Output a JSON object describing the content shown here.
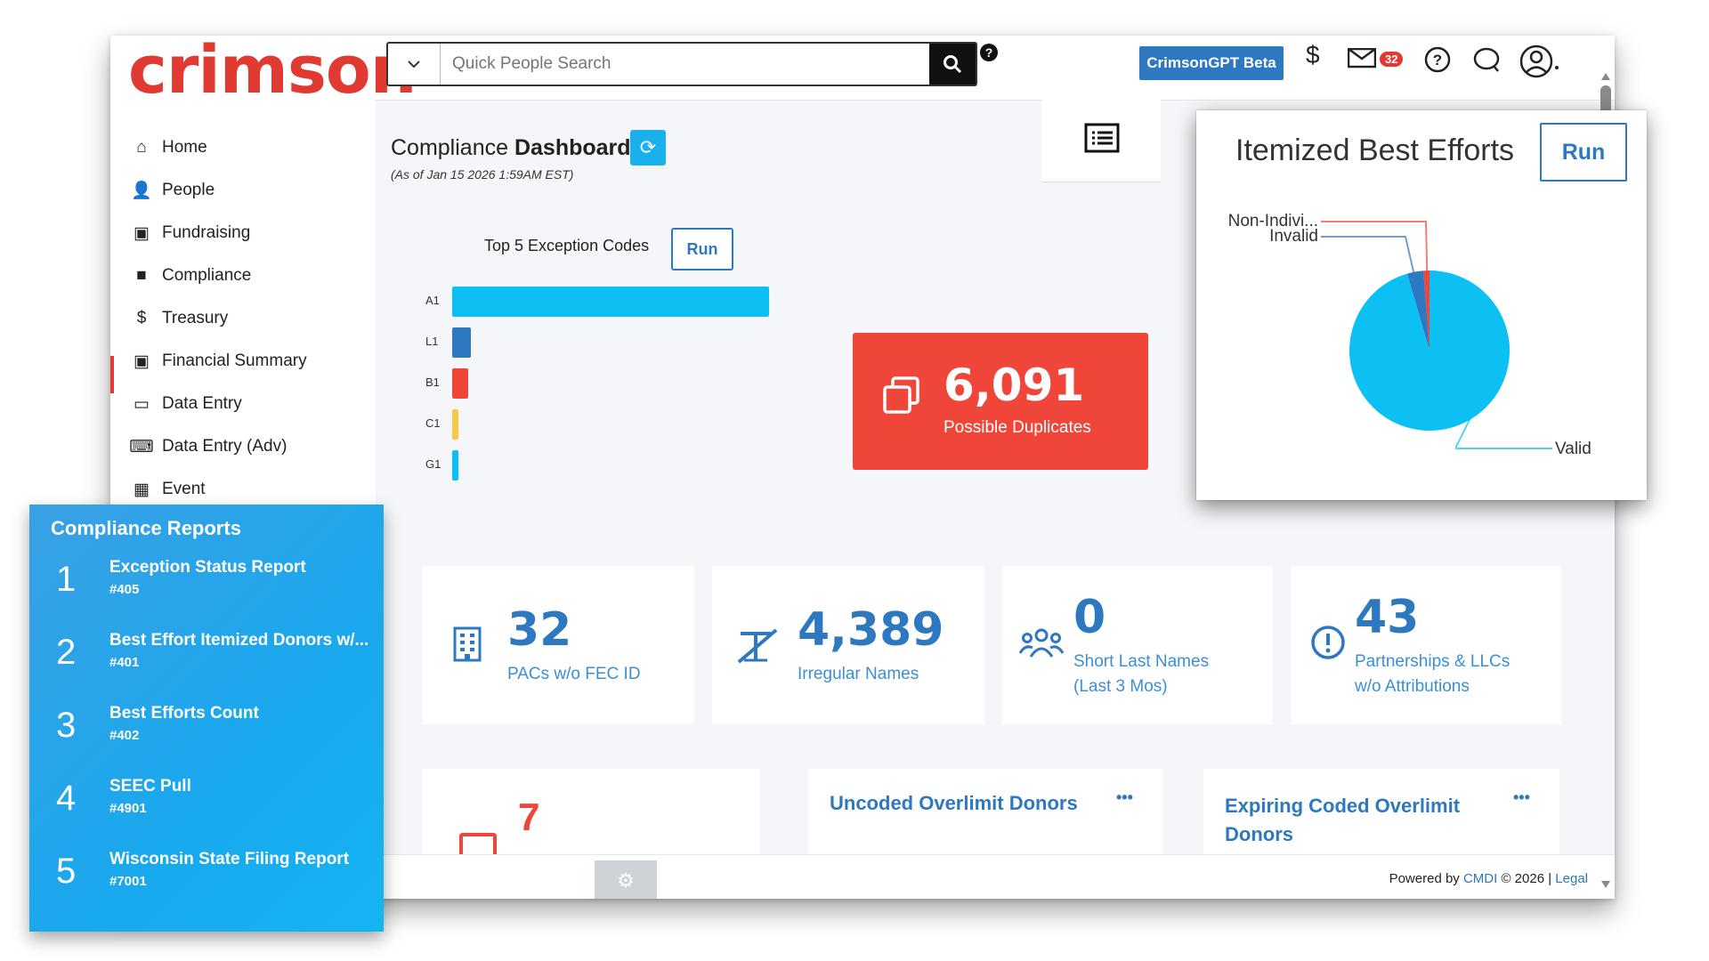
{
  "header": {
    "logo": "crimson",
    "search_placeholder": "Quick People Search",
    "help_glyph": "?",
    "gpt_label": "CrimsonGPT Beta",
    "mail_count": "32",
    "icons": [
      "dollar-icon",
      "mail-icon",
      "help-icon",
      "chat-icon",
      "user-icon"
    ]
  },
  "sidebar": {
    "items": [
      {
        "label": "Home",
        "icon": "home-icon"
      },
      {
        "label": "People",
        "icon": "person-icon"
      },
      {
        "label": "Fundraising",
        "icon": "money-icon"
      },
      {
        "label": "Compliance",
        "icon": "briefcase-icon"
      },
      {
        "label": "Treasury",
        "icon": "dollar-icon"
      },
      {
        "label": "Financial Summary",
        "icon": "money-icon"
      },
      {
        "label": "Data Entry",
        "icon": "folder-icon"
      },
      {
        "label": "Data Entry (Adv)",
        "icon": "keyboard-icon"
      },
      {
        "label": "Event",
        "icon": "calendar-icon"
      }
    ],
    "active": "Compliance"
  },
  "dashboard": {
    "title_light": "Compliance",
    "title_bold": "Dashboard",
    "as_of": "(As of Jan 15 2026 1:59AM EST)",
    "exceptions": {
      "label": "Top 5 Exception Codes",
      "run_label": "Run"
    },
    "duplicates": {
      "value": "6,091",
      "label": "Possible Duplicates"
    },
    "cards": [
      {
        "value": "32",
        "label_lines": [
          "PACs w/o FEC ID"
        ],
        "icon": "building-icon"
      },
      {
        "value": "4,389",
        "label_lines": [
          "Irregular Names"
        ],
        "icon": "text-strike-icon"
      },
      {
        "value": "0",
        "label_lines": [
          "Short Last Names",
          "(Last 3 Mos)"
        ],
        "icon": "users-icon"
      },
      {
        "value": "43",
        "label_lines": [
          "Partnerships & LLCs",
          "w/o Attributions"
        ],
        "icon": "alert-circle-icon"
      }
    ],
    "bottom": {
      "partial_value": "7",
      "uncoded_title": "Uncoded Overlimit Donors",
      "expiring_title_lines": [
        "Expiring Coded Overlimit",
        "Donors"
      ],
      "more_glyph": "•••"
    }
  },
  "footer": {
    "powered_prefix": "Powered by ",
    "powered_link": "CMDI",
    "powered_mid": " © 2026 | ",
    "legal": "Legal"
  },
  "popup": {
    "title": "Itemized Best Efforts",
    "run_label": "Run"
  },
  "reports": {
    "title": "Compliance Reports",
    "items": [
      {
        "num": "1",
        "name": "Exception Status Report",
        "id": "#405"
      },
      {
        "num": "2",
        "name": "Best Effort Itemized Donors w/...",
        "id": "#401"
      },
      {
        "num": "3",
        "name": "Best Efforts Count",
        "id": "#402"
      },
      {
        "num": "4",
        "name": "SEEC Pull",
        "id": "#4901"
      },
      {
        "num": "5",
        "name": "Wisconsin State Filing Report",
        "id": "#7001"
      }
    ]
  },
  "chart_data": [
    {
      "type": "bar",
      "orientation": "horizontal",
      "title": "Top 5 Exception Codes",
      "categories": [
        "A1",
        "L1",
        "B1",
        "C1",
        "G1"
      ],
      "values": [
        100,
        6,
        5,
        2,
        2
      ],
      "colors": [
        "#0cc0f4",
        "#2e78c0",
        "#f0463a",
        "#f7c948",
        "#0cc0f4"
      ],
      "grid": false
    },
    {
      "type": "pie",
      "title": "Itemized Best Efforts",
      "labels": [
        "Valid",
        "Invalid",
        "Non-Indivi..."
      ],
      "values": [
        95.5,
        3.3,
        1.2
      ],
      "colors": [
        "#0cc0f4",
        "#2e78c0",
        "#f0463a"
      ],
      "legend": "none"
    }
  ]
}
